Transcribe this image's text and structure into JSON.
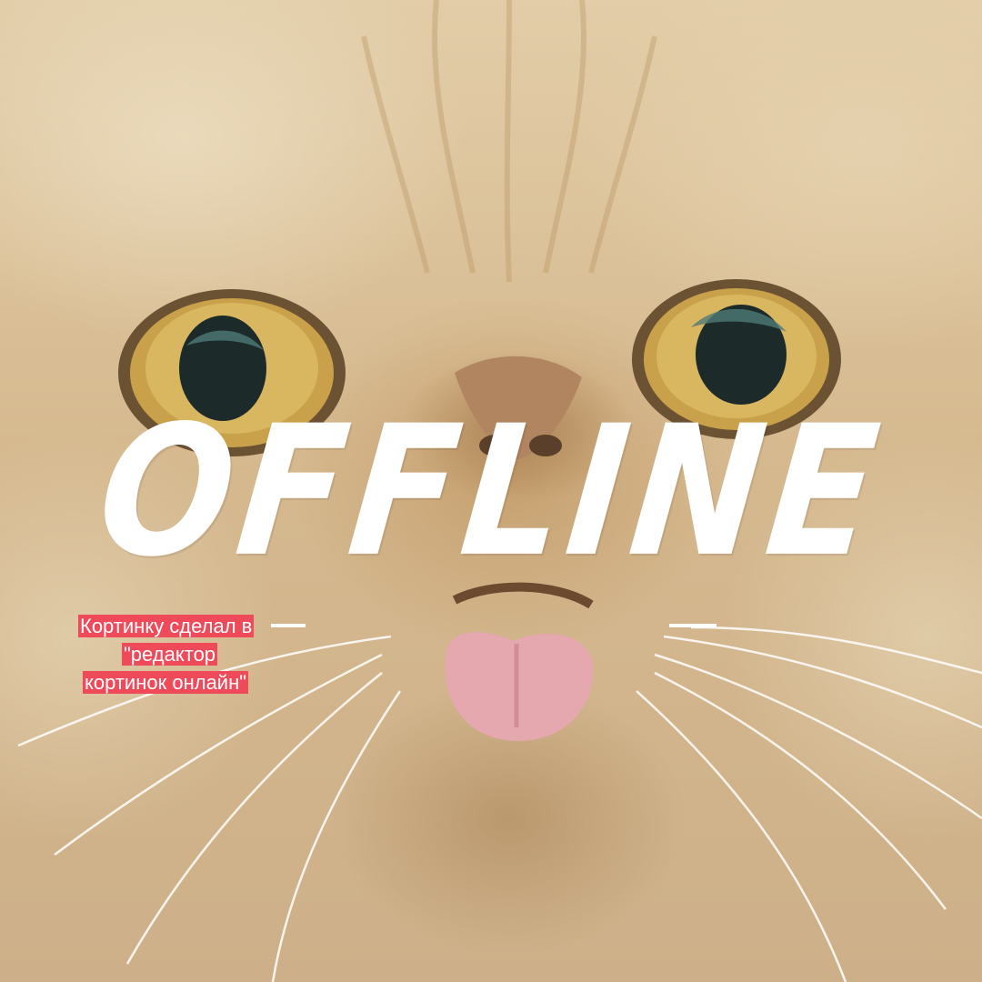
{
  "overlay": {
    "title": "OFFLINE",
    "caption_line1": "Кортинку сделал в",
    "caption_line2": "\"редактор",
    "caption_line3": "кортинок онлайн\""
  },
  "colors": {
    "title_text": "#ffffff",
    "caption_background": "#ef4a5a",
    "caption_text": "#ffffff",
    "fur": "#d6b98f"
  },
  "image": {
    "subject": "close-up cat face"
  }
}
